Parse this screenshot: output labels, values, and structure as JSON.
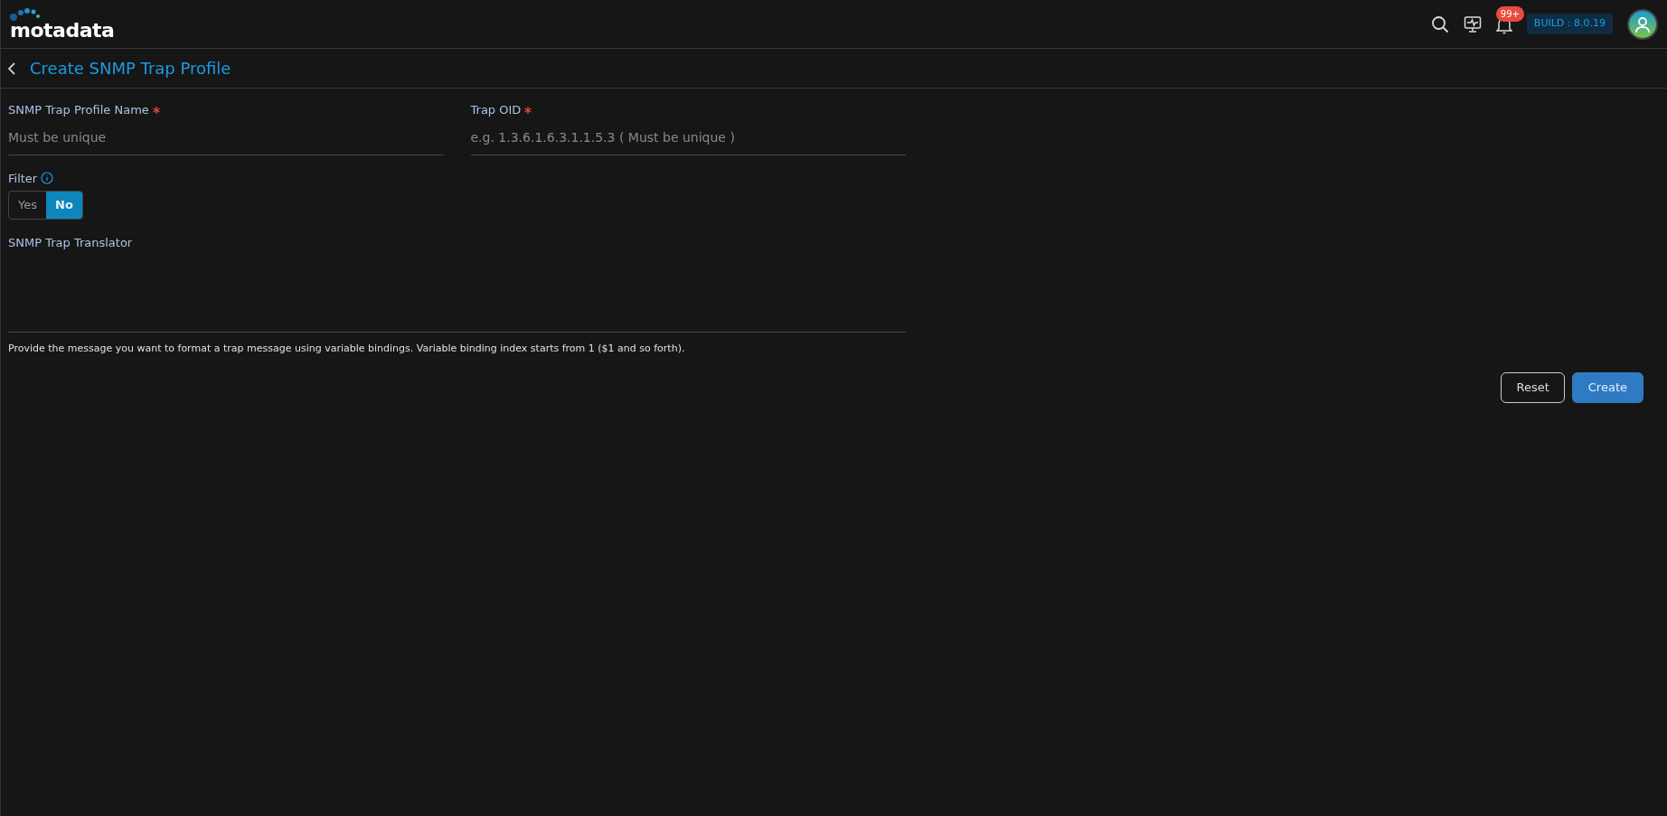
{
  "header": {
    "logo_text": "motadata",
    "notification_count": "99+",
    "build": "BUILD : 8.0.19"
  },
  "page": {
    "title": "Create SNMP Trap Profile"
  },
  "form": {
    "fields": [
      {
        "label": "SNMP Trap Profile Name",
        "required": true,
        "placeholder": "Must be unique"
      },
      {
        "label": "Trap OID",
        "required": true,
        "placeholder": "e.g. 1.3.6.1.6.3.1.1.5.3 ( Must be unique )"
      }
    ],
    "filter": {
      "label": "Filter",
      "options": [
        {
          "label": "Yes",
          "selected": false
        },
        {
          "label": "No",
          "selected": true
        }
      ]
    },
    "translator": {
      "label": "SNMP Trap Translator",
      "help": "Provide the message you want to format a trap message using variable bindings. Variable binding index starts from 1 ($1 and so forth)."
    }
  },
  "buttons": [
    {
      "label": "Reset",
      "kind": "outline"
    },
    {
      "label": "Create",
      "kind": "primary"
    }
  ]
}
